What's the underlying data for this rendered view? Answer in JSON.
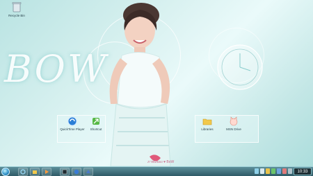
{
  "wallpaper": {
    "title_text": "BOW",
    "caption": "ภาพนี้ของ ♥ BoW"
  },
  "desktop": {
    "icons": [
      {
        "label": "Recycle Bin",
        "icon": "recycle-bin-icon"
      },
      {
        "label": "QuickTime Player",
        "icon": "quicktime-icon"
      },
      {
        "label": "Shortcut",
        "icon": "green-arrow-icon"
      },
      {
        "label": "Libraries",
        "icon": "folder-icon"
      },
      {
        "label": "MSN Drive",
        "icon": "cat-icon"
      }
    ]
  },
  "taskbar": {
    "clock_time": "10:33",
    "pinned": [
      "internet-explorer-icon",
      "windows-explorer-icon",
      "media-player-icon",
      "firefox-icon",
      "app-icon"
    ],
    "tray_icons": [
      "network-icon",
      "volume-icon",
      "flag-icon",
      "battery-icon",
      "msn-icon",
      "chat-icon",
      "shield-icon"
    ]
  },
  "colors": {
    "taskbar_top": "#5d8f9a",
    "taskbar_bottom": "#2f5b67",
    "wallpaper_main": "#d8f1f0"
  }
}
